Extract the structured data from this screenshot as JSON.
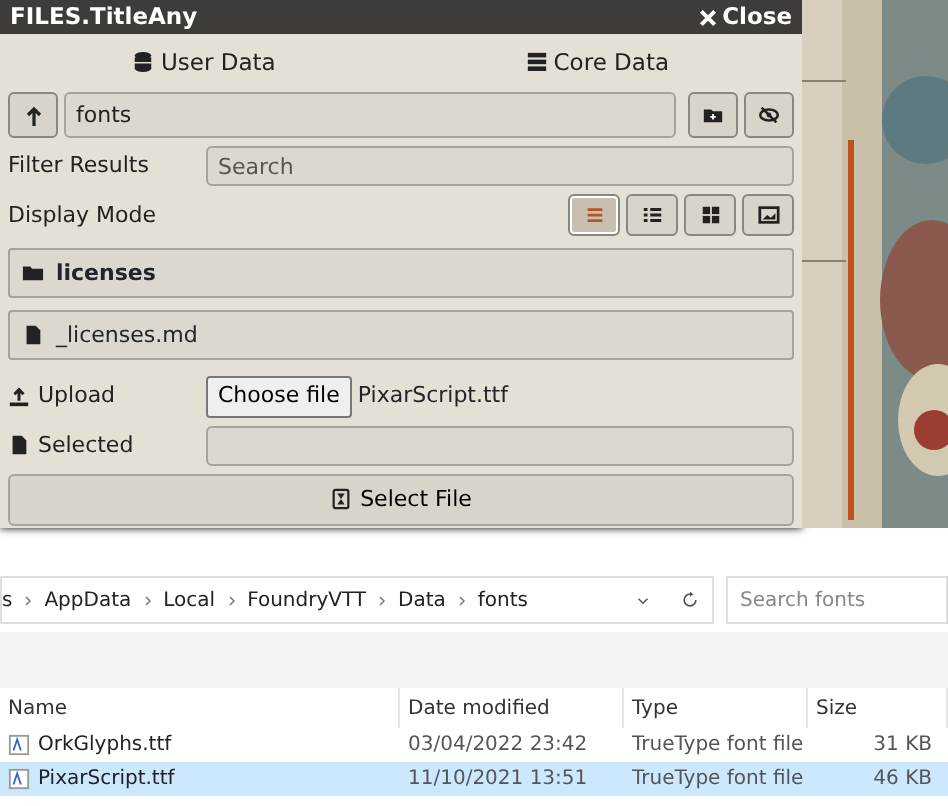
{
  "dialog": {
    "title": "FILES.TitleAny",
    "close": "Close",
    "sources": [
      {
        "label": "User Data",
        "kind": "user"
      },
      {
        "label": "Core Data",
        "kind": "core"
      }
    ],
    "path": {
      "value": "fonts"
    },
    "filter": {
      "label": "Filter Results",
      "placeholder": "Search"
    },
    "display_mode": {
      "label": "Display Mode",
      "modes": [
        {
          "kind": "list",
          "selected": true
        },
        {
          "kind": "bullets",
          "selected": false
        },
        {
          "kind": "tiles",
          "selected": false
        },
        {
          "kind": "images",
          "selected": false
        }
      ]
    },
    "entries": [
      {
        "name": "licenses",
        "kind": "folder"
      },
      {
        "name": "_licenses.md",
        "kind": "file"
      }
    ],
    "upload": {
      "label": "Upload",
      "button": "Choose file",
      "file": "PixarScript.ttf"
    },
    "selected": {
      "label": "Selected"
    },
    "select_button": "Select File"
  },
  "explorer": {
    "breadcrumb": [
      "s",
      "AppData",
      "Local",
      "FoundryVTT",
      "Data",
      "fonts"
    ],
    "search": {
      "placeholder": "Search fonts"
    },
    "columns": [
      "Name",
      "Date modified",
      "Type",
      "Size"
    ],
    "rows": [
      {
        "name": "OrkGlyphs.ttf",
        "date": "03/04/2022 23:42",
        "type": "TrueType font file",
        "size": "31 KB",
        "selected": false
      },
      {
        "name": "PixarScript.ttf",
        "date": "11/10/2021 13:51",
        "type": "TrueType font file",
        "size": "46 KB",
        "selected": true
      }
    ]
  }
}
